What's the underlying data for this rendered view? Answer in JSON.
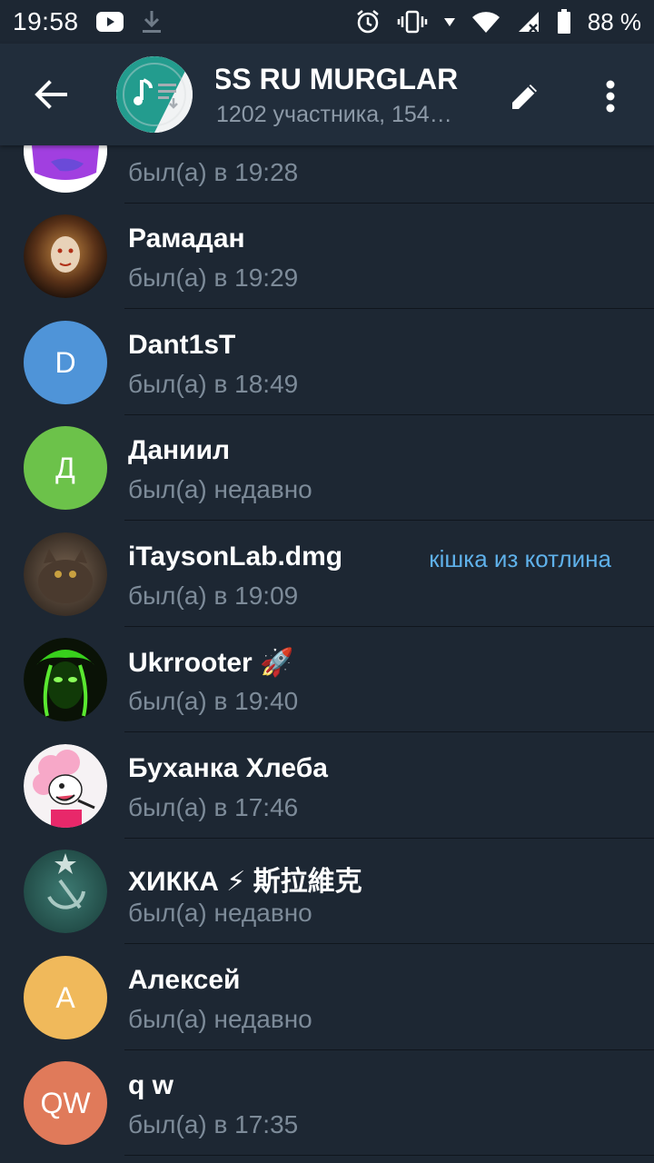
{
  "status_bar": {
    "time": "19:58",
    "battery": "88 %",
    "icons": [
      "youtube-icon",
      "download-icon",
      "alarm-icon",
      "vibrate-icon",
      "signal-icon",
      "wifi-icon",
      "battery-icon"
    ]
  },
  "header": {
    "title": "SS RU   MURGLAR",
    "subtitle": "1202 участника, 154…",
    "accent": "#212d3b"
  },
  "members": [
    {
      "name": "",
      "status": "был(а) в 19:28",
      "avatar_text": "",
      "avatar_color": "#9b3fd6"
    },
    {
      "name": "Рамадан",
      "status": "был(а) в 19:29",
      "avatar_text": "",
      "avatar_color": "#3a2418"
    },
    {
      "name": "Dant1sT",
      "status": "был(а) в 18:49",
      "avatar_text": "D",
      "avatar_color": "#4f94d8"
    },
    {
      "name": "Даниил",
      "status": "был(а) недавно",
      "avatar_text": "Д",
      "avatar_color": "#6cc24a"
    },
    {
      "name": "iTaysonLab.dmg",
      "status": "был(а) в 19:09",
      "role": "кішка из котлина",
      "avatar_text": "",
      "avatar_color": "#5a4a3e"
    },
    {
      "name": " Ukrrooter 🚀",
      "status": "был(а) в 19:40",
      "avatar_text": "",
      "avatar_color": "#0c1a08"
    },
    {
      "name": "Буханка Хлеба",
      "status": "был(а) в 17:46",
      "avatar_text": "",
      "avatar_color": "#f4f0f2"
    },
    {
      "name": "ХИККА ⚡ 斯拉維克",
      "status": "был(а) недавно",
      "avatar_text": "",
      "avatar_color": "#2d5e5a"
    },
    {
      "name": "Алексей",
      "status": "был(а) недавно",
      "avatar_text": "А",
      "avatar_color": "#f0b95b"
    },
    {
      "name": "q w",
      "status": "был(а) в 17:35",
      "avatar_text": "QW",
      "avatar_color": "#e07a5a"
    }
  ]
}
